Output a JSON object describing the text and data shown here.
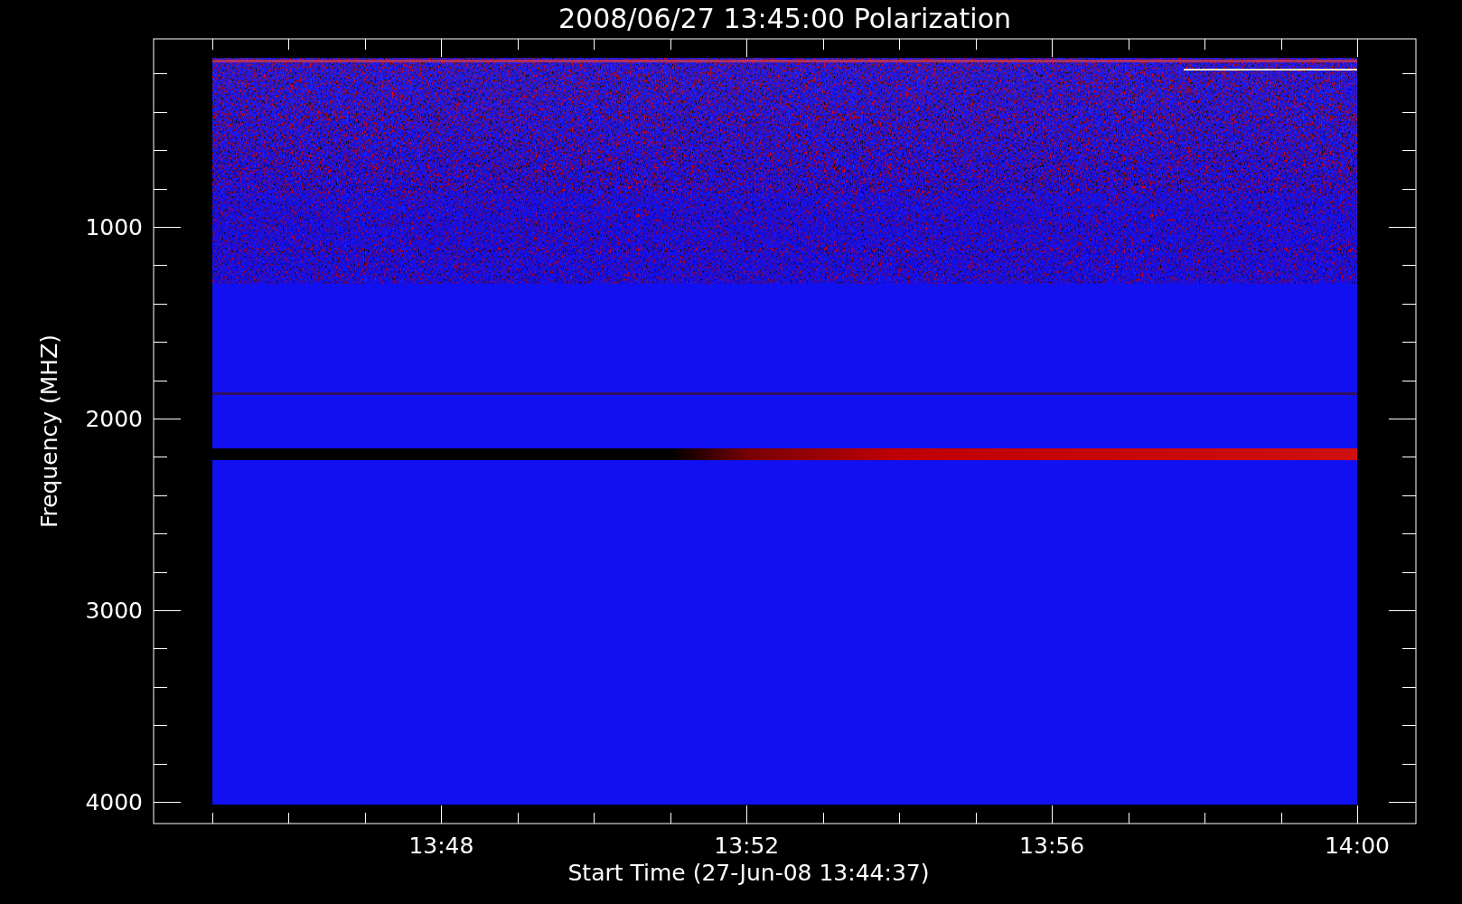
{
  "title": "2008/06/27 13:45:00 Polarization",
  "y_axis": {
    "label": "Frequency (MHZ)",
    "ticks": [
      "1000",
      "2000",
      "3000",
      "4000"
    ]
  },
  "x_axis": {
    "label": "Start Time (27-Jun-08 13:44:37)",
    "ticks": [
      "13:48",
      "13:52",
      "13:56",
      "14:00"
    ]
  }
}
